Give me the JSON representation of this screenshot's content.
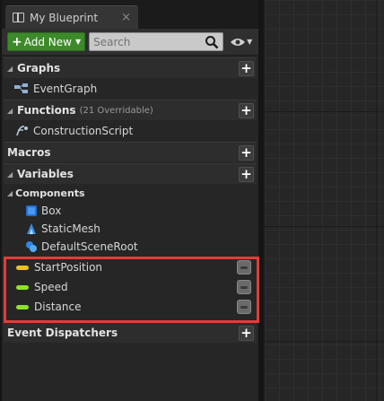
{
  "tab": {
    "title": "My Blueprint",
    "close": "×"
  },
  "toolbar": {
    "add_new": "Add New",
    "search_placeholder": "Search"
  },
  "categories": {
    "graphs": {
      "label": "Graphs"
    },
    "functions": {
      "label": "Functions",
      "sub": "(21 Overridable)"
    },
    "macros": {
      "label": "Macros"
    },
    "variables": {
      "label": "Variables"
    },
    "event_dispatchers": {
      "label": "Event Dispatchers"
    }
  },
  "graphs_items": [
    "EventGraph"
  ],
  "functions_items": [
    "ConstructionScript"
  ],
  "components": {
    "label": "Components",
    "items": [
      "Box",
      "StaticMesh",
      "DefaultSceneRoot"
    ]
  },
  "variables": [
    {
      "name": "StartPosition",
      "color": "#e8c12a"
    },
    {
      "name": "Speed",
      "color": "#8ee22a"
    },
    {
      "name": "Distance",
      "color": "#8ee22a"
    }
  ],
  "colors": {
    "add_new": "#3c8a2a",
    "highlight": "#e23c3c"
  }
}
